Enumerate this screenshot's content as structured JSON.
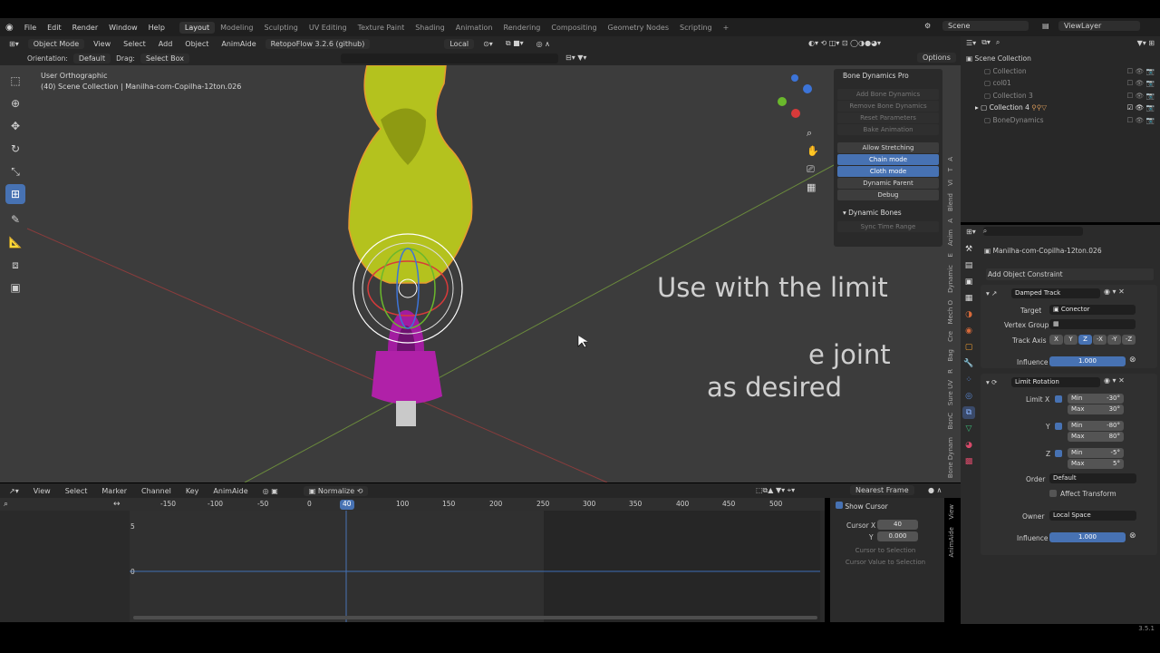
{
  "menu": {
    "items": [
      "File",
      "Edit",
      "Render",
      "Window",
      "Help"
    ],
    "workspaces": [
      "Layout",
      "Modeling",
      "Sculpting",
      "UV Editing",
      "Texture Paint",
      "Shading",
      "Animation",
      "Rendering",
      "Compositing",
      "Geometry Nodes",
      "Scripting"
    ],
    "active_workspace": "Layout",
    "scene": "Scene",
    "view_layer": "ViewLayer"
  },
  "header": {
    "mode": "Object Mode",
    "view": "View",
    "select": "Select",
    "add": "Add",
    "object": "Object",
    "animaide": "AnimAide",
    "addon": "RetopoFlow 3.2.6 (github)",
    "transform": "Local",
    "orientation_label": "Orientation:",
    "orientation": "Default",
    "drag_label": "Drag:",
    "drag": "Select Box",
    "options": "Options"
  },
  "viewport": {
    "view_name": "User Orthographic",
    "collection_info": "(40) Scene Collection | Manilha-com-Copilha-12ton.026",
    "overlay_line1": "Use with the limit",
    "overlay_line2": "e joint",
    "overlay_line3": "as desired"
  },
  "bone_panel": {
    "title": "Bone Dynamics Pro",
    "buttons_disabled": [
      "Add Bone Dynamics",
      "Remove Bone Dynamics",
      "Reset Parameters",
      "Bake Animation"
    ],
    "allow_stretching": "Allow Stretching",
    "chain_mode": "Chain mode",
    "cloth_mode": "Cloth mode",
    "dynamic_parent": "Dynamic Parent",
    "debug": "Debug",
    "dynamic_bones": "Dynamic Bones",
    "sync_time_range": "Sync Time Range"
  },
  "viewport_tabs": [
    "Bone Dynam",
    "BonC",
    "Sure UV",
    "R",
    "Bag",
    "Cre",
    "Mech O",
    "Dynamic",
    "E",
    "Anim",
    "A",
    "Blend",
    "VI",
    "T",
    "A"
  ],
  "timeline": {
    "menu": [
      "View",
      "Select",
      "Marker",
      "Channel",
      "Key",
      "AnimAide"
    ],
    "normalize": "Normalize",
    "snap": "Nearest Frame",
    "ruler": [
      "-150",
      "-100",
      "-50",
      "0",
      "40",
      "100",
      "150",
      "200",
      "250",
      "300",
      "350",
      "400",
      "450",
      "500"
    ],
    "current_frame": "40",
    "y_labels": [
      "5",
      "0"
    ],
    "show_cursor": "Show Cursor",
    "cursor_x_label": "Cursor X",
    "cursor_x": "40",
    "cursor_y_label": "Y",
    "cursor_y": "0.000",
    "cursor_to_selection": "Cursor to Selection",
    "cursor_value_to_selection": "Cursor Value to Selection",
    "side_tabs": [
      "View",
      "AnimAide"
    ]
  },
  "outliner": {
    "root": "Scene Collection",
    "items": [
      "Collection",
      "col01",
      "Collection 3",
      "Collection 4",
      "BoneDynamics"
    ]
  },
  "properties": {
    "object_name": "Manilha-com-Copilha-12ton.026",
    "add_constraint": "Add Object Constraint",
    "c1": {
      "name": "Damped Track",
      "target_label": "Target",
      "target": "Conector",
      "vgroup_label": "Vertex Group",
      "track_label": "Track Axis",
      "axes": [
        "X",
        "Y",
        "Z",
        "-X",
        "-Y",
        "-Z"
      ],
      "influence_label": "Influence",
      "influence": "1.000"
    },
    "c2": {
      "name": "Limit Rotation",
      "limit_x": "Limit X",
      "y": "Y",
      "z": "Z",
      "min": "Min",
      "max": "Max",
      "x_min": "-30°",
      "x_max": "30°",
      "y_min": "-80°",
      "y_max": "80°",
      "z_min": "-5°",
      "z_max": "5°",
      "order_label": "Order",
      "order": "Default",
      "affect_transform": "Affect Transform",
      "owner_label": "Owner",
      "owner": "Local Space",
      "influence_label": "Influence",
      "influence": "1.000"
    }
  },
  "status": {
    "version": "3.5.1"
  }
}
